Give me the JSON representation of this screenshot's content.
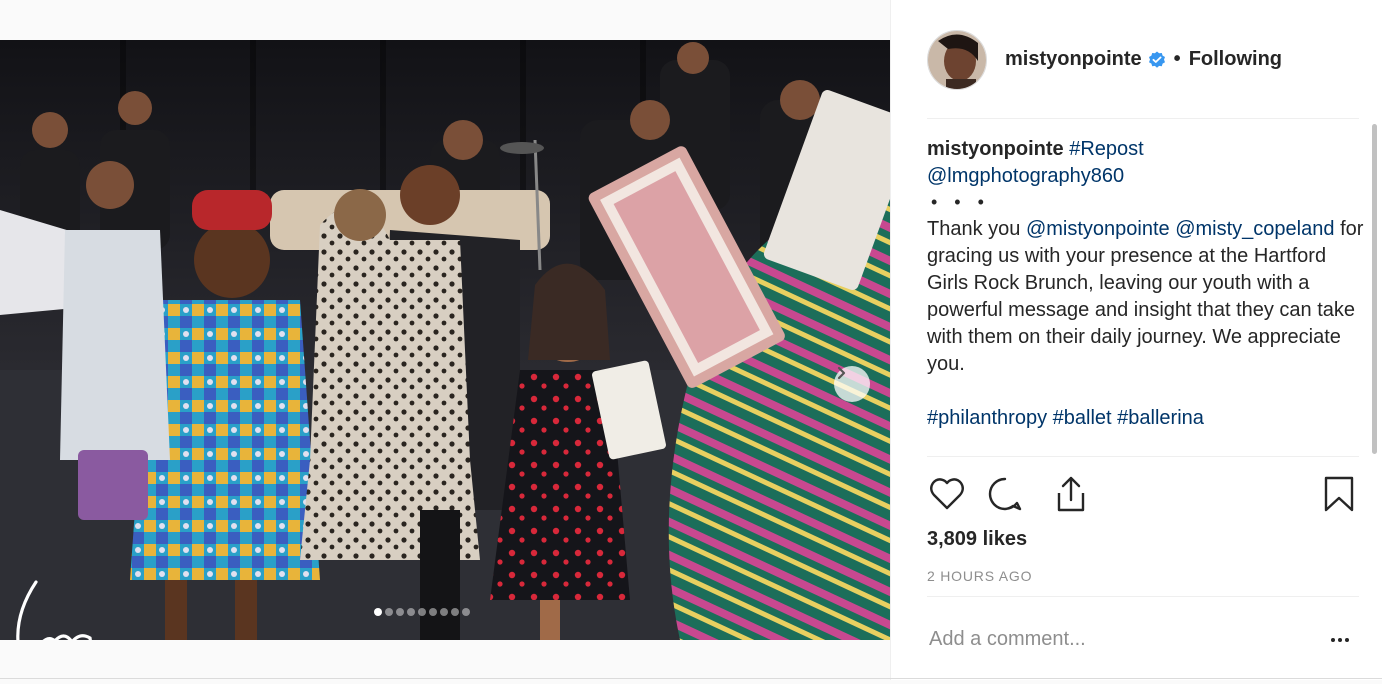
{
  "post": {
    "username": "mistyonpointe",
    "separator": "•",
    "follow_label": "Following",
    "caption": {
      "username": "mistyonpointe",
      "repost_tag": "#Repost",
      "credit_mention": "@lmgphotography860",
      "dots": "• • •",
      "text_1": "Thank you",
      "mention_1": "@mistyonpointe",
      "mention_2": "@misty_copeland",
      "text_2": "for gracing us with your presence at the Hartford Girls Rock Brunch, leaving our youth with a powerful message and insight that they can take with them on their daily journey. We appreciate you.",
      "hashtags": [
        "#philanthropy",
        "#ballet",
        "#ballerina"
      ]
    },
    "likes_text": "3,809 likes",
    "time_text": "2 HOURS AGO",
    "comment_placeholder": "Add a comment...",
    "carousel": {
      "slide_count": 9,
      "active_index": 0
    },
    "icons": {
      "verified": "verified-badge-icon",
      "like": "heart-icon",
      "comment": "comment-bubble-icon",
      "share": "share-icon",
      "save": "bookmark-icon",
      "next": "chevron-right-icon",
      "more": "more-options-icon"
    },
    "colors": {
      "link": "#003569",
      "verified": "#3897f0",
      "muted": "#8e8e8e",
      "text": "#262626"
    }
  }
}
